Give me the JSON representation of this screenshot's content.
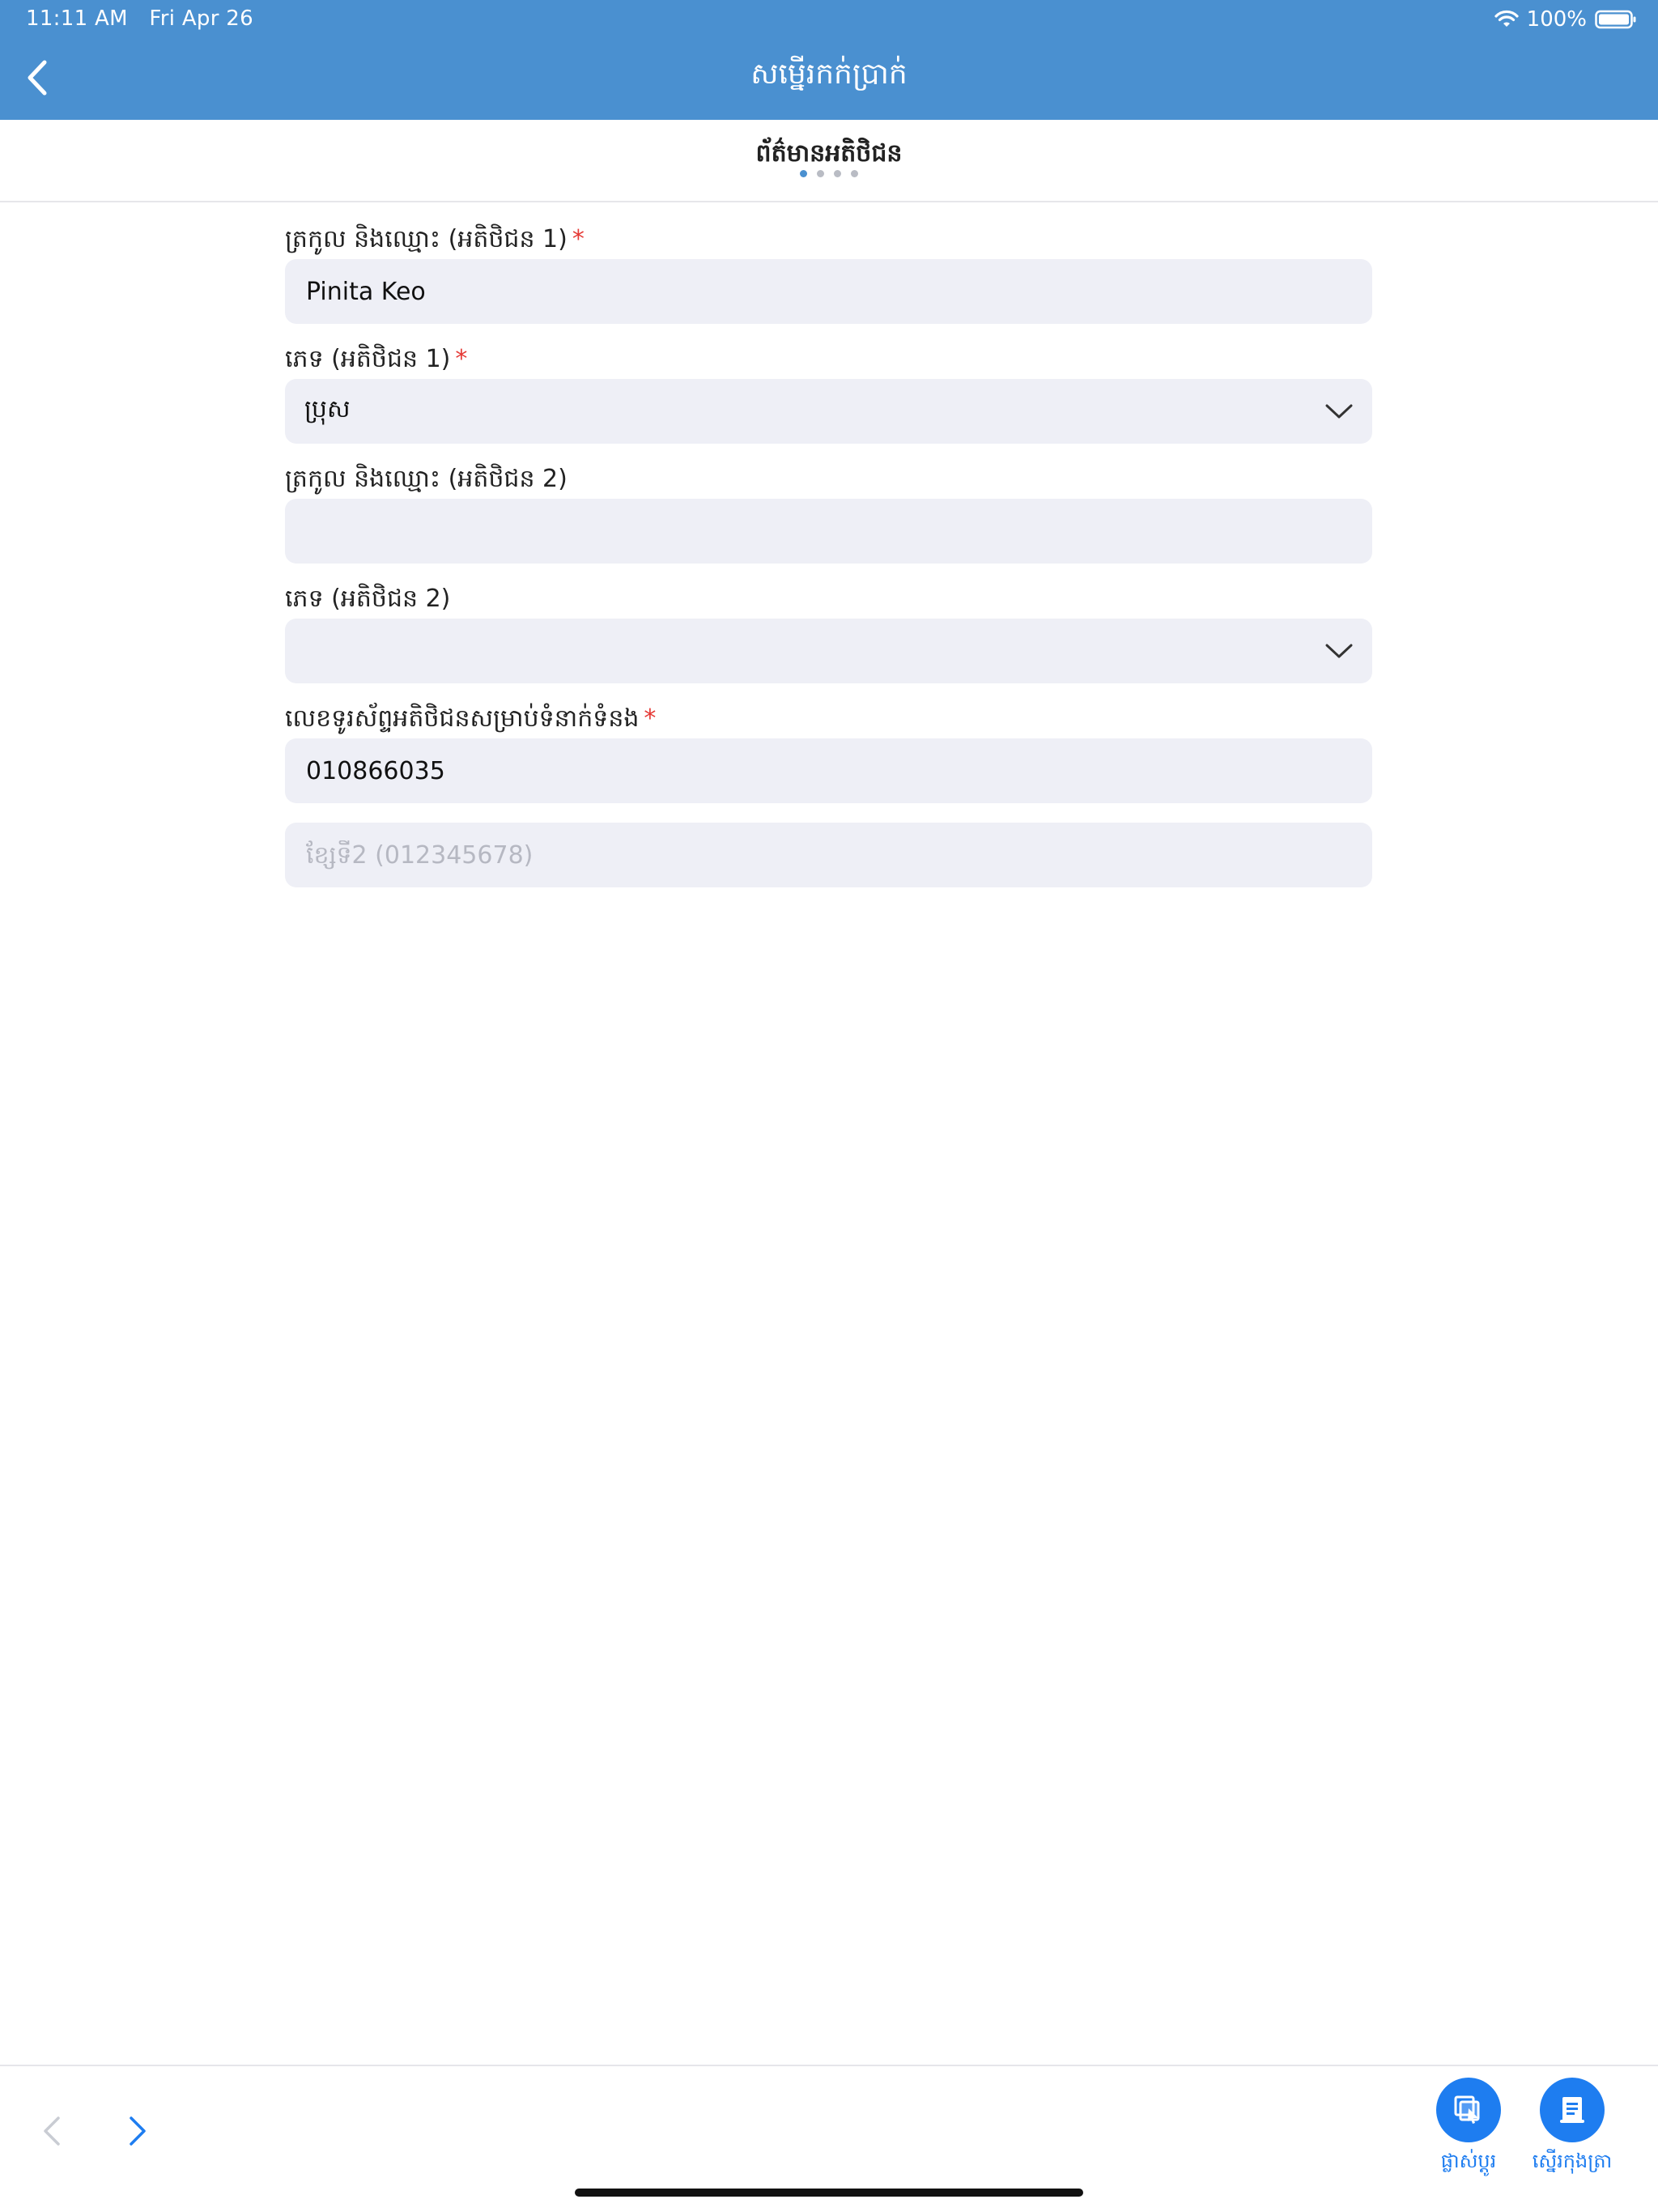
{
  "status_bar": {
    "time": "11:11 AM",
    "date": "Fri Apr 26",
    "battery": "100%"
  },
  "header": {
    "title": "សម្នើរកក់ប្រាក់"
  },
  "step": {
    "title": "ព័ត៌មានអតិថិជន",
    "current": 1,
    "total": 4
  },
  "form": {
    "name1": {
      "label": "ត្រកូល និងឈ្មោះ (អតិថិជន 1)",
      "required": "*",
      "value": "Pinita Keo"
    },
    "gender1": {
      "label": "ភេទ (អតិថិជន 1)",
      "required": "*",
      "value": "ប្រុស"
    },
    "name2": {
      "label": "ត្រកូល និងឈ្មោះ (អតិថិជន 2)",
      "value": ""
    },
    "gender2": {
      "label": "ភេទ (អតិថិជន 2)",
      "value": ""
    },
    "phone": {
      "label": "លេខទូរស័ព្ទអតិថិជនសម្រាប់ទំនាក់ទំនង",
      "required": "*",
      "value": "010866035"
    },
    "phone2": {
      "placeholder": "ខ្សែទី2 (012345678)",
      "value": ""
    }
  },
  "toolbar": {
    "change_label": "ផ្លាស់ប្តូរ",
    "save_label": "ស្នើរកុងត្រា"
  },
  "colors": {
    "primary": "#4a90d0",
    "accent": "#1e7df0",
    "required": "#e53935",
    "field_bg": "#eeeff6"
  }
}
